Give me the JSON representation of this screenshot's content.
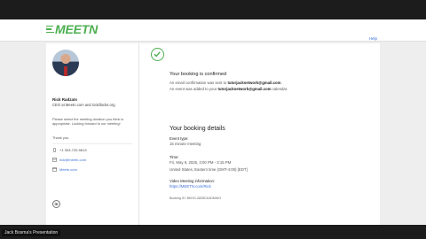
{
  "header": {
    "logo_text": "MEETN",
    "help_label": "Help"
  },
  "host": {
    "name": "Rick Radzats",
    "title": "CEO at Meetn.com and Goldlocks.org",
    "message": "Please select the meeting duration you think is appropriate. Looking forward to our meeting!",
    "thanks": "Thank you.",
    "phone": "+1 303-720-9613",
    "email": "rick@meetn.com",
    "website": "Meetn.com",
    "linkedin_label": "in"
  },
  "confirmation": {
    "title": "Your booking is confirmed",
    "email_sent_prefix": "An email confirmation was sent to ",
    "email_sent_address": "tutorjacknetwork@gmail.com",
    "email_sent_suffix": ".",
    "event_added_prefix": "An event was added to your ",
    "event_added_address": "tutorjacknetwork@gmail.com",
    "event_added_suffix": " calendar."
  },
  "details": {
    "title": "Your booking details",
    "event_type_label": "Event type:",
    "event_type_value": "15 minute meeting",
    "time_label": "Time:",
    "time_value": "Fri, May 9, 2025, 3:00 PM - 3:15 PM",
    "timezone_value": "United States, Eastern time (GMT-4:00) [EDT]",
    "video_label": "Video Meeting information:",
    "video_link": "https://MEETN.com/Rick",
    "booking_id": "Booking ID: BKHG-Z835DU4DMWG"
  },
  "footer": {
    "presenter_label": "Jack Bosma's Presentation"
  }
}
